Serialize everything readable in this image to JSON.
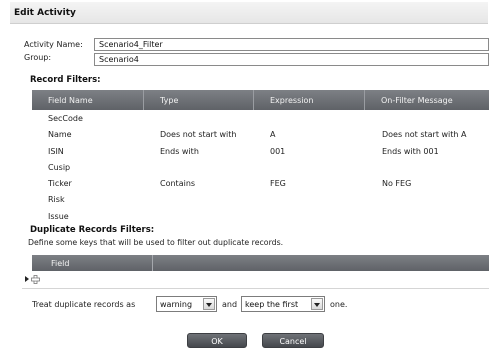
{
  "dialog": {
    "title": "Edit Activity"
  },
  "form": {
    "activity_name_label": "Activity Name:",
    "activity_name_value": "Scenario4_Filter",
    "group_label": "Group:",
    "group_value": "Scenario4"
  },
  "record_filters": {
    "heading": "Record Filters:",
    "columns": [
      "Field Name",
      "Type",
      "Expression",
      "On-Filter Message"
    ],
    "rows": [
      {
        "field": "SecCode",
        "type": "",
        "expression": "",
        "message": ""
      },
      {
        "field": "Name",
        "type": "Does not start with",
        "expression": "A",
        "message": "Does not start with A"
      },
      {
        "field": "ISIN",
        "type": "Ends with",
        "expression": "001",
        "message": "Ends with 001"
      },
      {
        "field": "Cusip",
        "type": "",
        "expression": "",
        "message": ""
      },
      {
        "field": "Ticker",
        "type": "Contains",
        "expression": "FEG",
        "message": "No FEG"
      },
      {
        "field": "Risk",
        "type": "",
        "expression": "",
        "message": ""
      },
      {
        "field": "Issue",
        "type": "",
        "expression": "",
        "message": ""
      }
    ]
  },
  "duplicate_filters": {
    "heading": "Duplicate Records Filters:",
    "description": "Define some keys that will be used to filter out duplicate records.",
    "columns": [
      "Field"
    ],
    "add_row_icon": "add-row-icon"
  },
  "treat": {
    "prefix": "Treat duplicate records as",
    "mode_value": "warning",
    "middle": "and",
    "keep_value": "keep the first",
    "suffix": "one."
  },
  "buttons": {
    "ok": "OK",
    "cancel": "Cancel"
  },
  "colors": {
    "grid_header": "#6e7176",
    "button": "#5a5d62"
  }
}
